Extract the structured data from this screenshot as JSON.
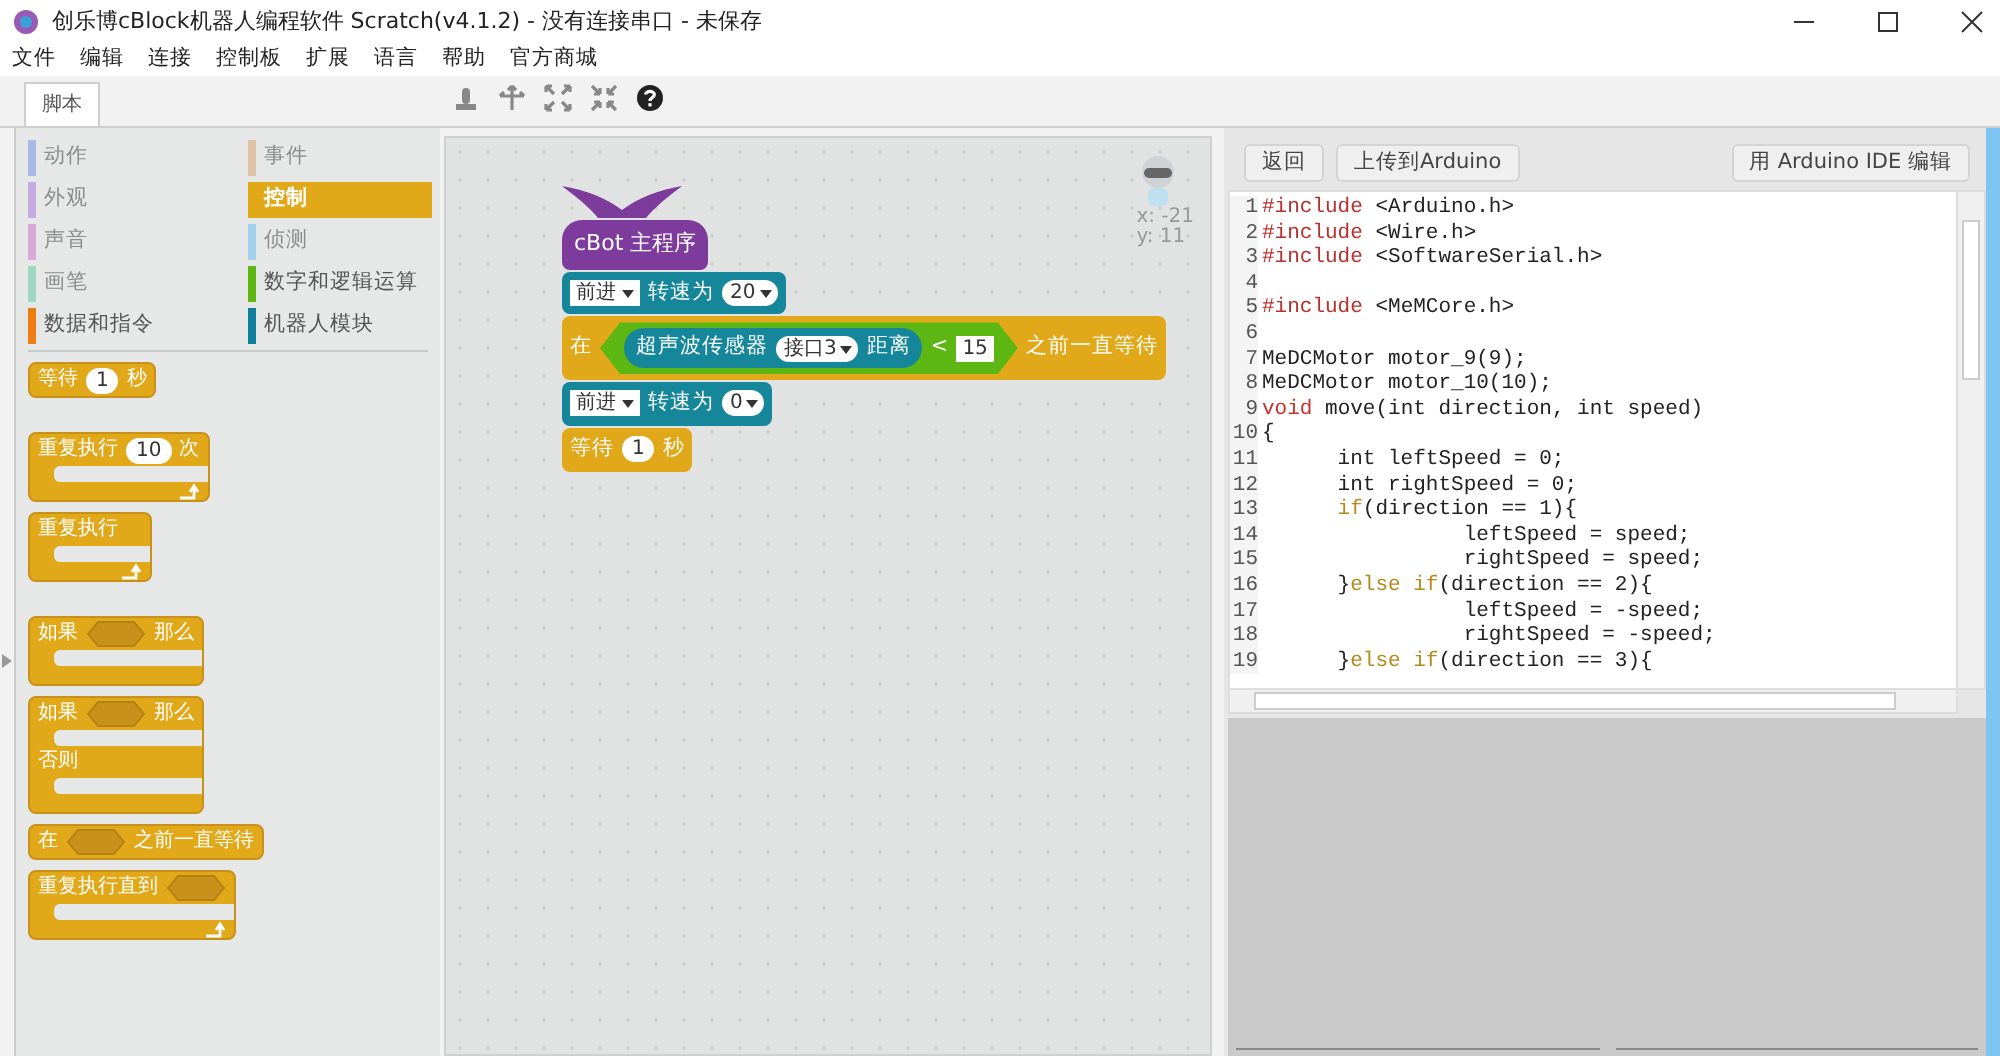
{
  "window": {
    "title": "创乐博cBlock机器人编程软件 Scratch(v4.1.2) - 没有连接串口 - 未保存"
  },
  "menu": [
    "文件",
    "编辑",
    "连接",
    "控制板",
    "扩展",
    "语言",
    "帮助",
    "官方商城"
  ],
  "tabs": [
    {
      "label": "脚本",
      "selected": true
    }
  ],
  "categories": [
    {
      "name": "动作",
      "color": "#aab8e6",
      "disabled": true,
      "selected": false
    },
    {
      "name": "事件",
      "color": "#dfc3a6",
      "disabled": true,
      "selected": false
    },
    {
      "name": "外观",
      "color": "#c7aae0",
      "disabled": true,
      "selected": false
    },
    {
      "name": "控制",
      "color": "#e1a91a",
      "disabled": false,
      "selected": true
    },
    {
      "name": "声音",
      "color": "#d9a9d9",
      "disabled": true,
      "selected": false
    },
    {
      "name": "侦测",
      "color": "#a3d0ec",
      "disabled": true,
      "selected": false
    },
    {
      "name": "画笔",
      "color": "#a0d7c4",
      "disabled": true,
      "selected": false
    },
    {
      "name": "数字和逻辑运算",
      "color": "#5cb712",
      "disabled": false,
      "selected": false
    },
    {
      "name": "数据和指令",
      "color": "#ee7d16",
      "disabled": false,
      "selected": false
    },
    {
      "name": "机器人模块",
      "color": "#0e7f9a",
      "disabled": false,
      "selected": false
    }
  ],
  "palette_blocks": [
    {
      "kind": "stack",
      "parts": [
        {
          "kind": "text",
          "text": "等待"
        },
        {
          "kind": "number",
          "text": "1"
        },
        {
          "kind": "text",
          "text": "秒"
        }
      ]
    },
    {
      "kind": "c",
      "loops": true,
      "parts": [
        {
          "kind": "text",
          "text": "重复执行"
        },
        {
          "kind": "number",
          "text": "10"
        },
        {
          "kind": "text",
          "text": "次"
        }
      ]
    },
    {
      "kind": "c",
      "loops": true,
      "parts": [
        {
          "kind": "text",
          "text": "重复执行"
        }
      ]
    },
    {
      "kind": "c",
      "loops": false,
      "parts": [
        {
          "kind": "text",
          "text": "如果"
        },
        {
          "kind": "slot"
        },
        {
          "kind": "text",
          "text": "那么"
        }
      ]
    },
    {
      "kind": "ifelse",
      "loops": false,
      "else_label": "否则",
      "parts": [
        {
          "kind": "text",
          "text": "如果"
        },
        {
          "kind": "slot"
        },
        {
          "kind": "text",
          "text": "那么"
        }
      ]
    },
    {
      "kind": "stack",
      "parts": [
        {
          "kind": "text",
          "text": "在"
        },
        {
          "kind": "slot"
        },
        {
          "kind": "text",
          "text": "之前一直等待"
        }
      ]
    },
    {
      "kind": "c",
      "loops": true,
      "parts": [
        {
          "kind": "text",
          "text": "重复执行直到"
        },
        {
          "kind": "slot"
        }
      ]
    }
  ],
  "script_blocks": [
    {
      "kind": "hat",
      "color": "#7d3b9b",
      "parts": [
        {
          "kind": "text",
          "text": "cBot 主程序"
        }
      ]
    },
    {
      "kind": "stack",
      "color": "#16879b",
      "parts": [
        {
          "kind": "dropdown",
          "text": "前进"
        },
        {
          "kind": "text",
          "text": "转速为"
        },
        {
          "kind": "round-dropdown",
          "text": "20"
        }
      ]
    },
    {
      "kind": "stack",
      "color": "#e1a91a",
      "parts": [
        {
          "kind": "text",
          "text": "在"
        },
        {
          "kind": "boolean",
          "parts": [
            {
              "kind": "reporter",
              "parts": [
                {
                  "kind": "text",
                  "text": "超声波传感器"
                },
                {
                  "kind": "round-dropdown",
                  "text": "接口3"
                },
                {
                  "kind": "text",
                  "text": "距离"
                }
              ]
            },
            {
              "kind": "text",
              "text": "<"
            },
            {
              "kind": "square",
              "text": "15"
            }
          ]
        },
        {
          "kind": "text",
          "text": "之前一直等待"
        }
      ]
    },
    {
      "kind": "stack",
      "color": "#16879b",
      "parts": [
        {
          "kind": "dropdown",
          "text": "前进"
        },
        {
          "kind": "text",
          "text": "转速为"
        },
        {
          "kind": "round-dropdown",
          "text": "0"
        }
      ]
    },
    {
      "kind": "stack",
      "color": "#e1a91a",
      "parts": [
        {
          "kind": "text",
          "text": "等待"
        },
        {
          "kind": "number",
          "text": "1"
        },
        {
          "kind": "text",
          "text": "秒"
        }
      ]
    }
  ],
  "sprite": {
    "x": "x: -21",
    "y": "y: 11"
  },
  "code_panel": {
    "buttons": [
      "返回",
      "上传到Arduino"
    ],
    "edit_button": "用 Arduino IDE 编辑",
    "lines": [
      {
        "num": "1",
        "segments": [
          {
            "kind": "keyword",
            "text": "#include"
          },
          {
            "kind": "plain",
            "text": " <Arduino.h>"
          }
        ]
      },
      {
        "num": "2",
        "segments": [
          {
            "kind": "keyword",
            "text": "#include"
          },
          {
            "kind": "plain",
            "text": " <Wire.h>"
          }
        ]
      },
      {
        "num": "3",
        "segments": [
          {
            "kind": "keyword",
            "text": "#include"
          },
          {
            "kind": "plain",
            "text": " <SoftwareSerial.h>"
          }
        ]
      },
      {
        "num": "4"
      },
      {
        "num": "5",
        "segments": [
          {
            "kind": "keyword",
            "text": "#include"
          },
          {
            "kind": "plain",
            "text": " <MeMCore.h>"
          }
        ]
      },
      {
        "num": "6"
      },
      {
        "num": "7",
        "segments": [
          {
            "kind": "plain",
            "text": "MeDCMotor motor_9(9);"
          }
        ]
      },
      {
        "num": "8",
        "segments": [
          {
            "kind": "plain",
            "text": "MeDCMotor motor_10(10);"
          }
        ]
      },
      {
        "num": "9",
        "segments": [
          {
            "kind": "type",
            "text": "void"
          },
          {
            "kind": "plain",
            "text": " move(int direction, int speed)"
          }
        ]
      },
      {
        "num": "10",
        "segments": [
          {
            "kind": "plain",
            "text": "{"
          }
        ]
      },
      {
        "num": "11",
        "segments": [
          {
            "kind": "plain",
            "text": "      int leftSpeed = 0;"
          }
        ]
      },
      {
        "num": "12",
        "segments": [
          {
            "kind": "plain",
            "text": "      int rightSpeed = 0;"
          }
        ]
      },
      {
        "num": "13",
        "segments": [
          {
            "kind": "control",
            "text": "      if"
          },
          {
            "kind": "plain",
            "text": "(direction == 1){"
          }
        ]
      },
      {
        "num": "14",
        "segments": [
          {
            "kind": "plain",
            "text": "                leftSpeed = speed;"
          }
        ]
      },
      {
        "num": "15",
        "segments": [
          {
            "kind": "plain",
            "text": "                rightSpeed = speed;"
          }
        ]
      },
      {
        "num": "16",
        "segments": [
          {
            "kind": "plain",
            "text": "      }"
          },
          {
            "kind": "control",
            "text": "else if"
          },
          {
            "kind": "plain",
            "text": "(direction == 2){"
          }
        ]
      },
      {
        "num": "17",
        "segments": [
          {
            "kind": "plain",
            "text": "                leftSpeed = -speed;"
          }
        ]
      },
      {
        "num": "18",
        "segments": [
          {
            "kind": "plain",
            "text": "                rightSpeed = -speed;"
          }
        ]
      },
      {
        "num": "19",
        "segments": [
          {
            "kind": "plain",
            "text": "      }"
          },
          {
            "kind": "control",
            "text": "else if"
          },
          {
            "kind": "plain",
            "text": "(direction == 3){"
          }
        ]
      }
    ]
  }
}
